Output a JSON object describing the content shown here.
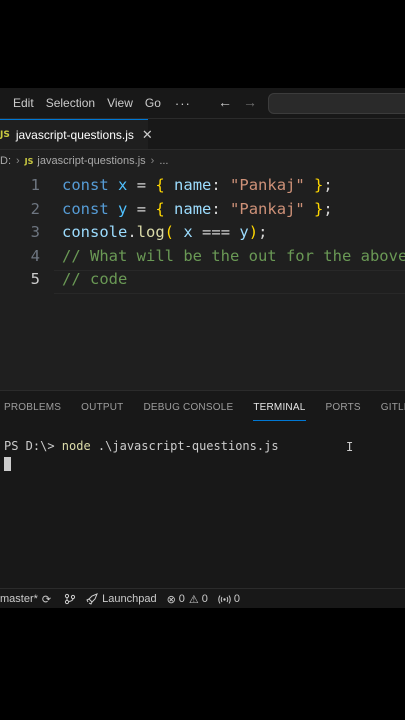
{
  "menubar": {
    "items": [
      "Edit",
      "Selection",
      "View",
      "Go"
    ],
    "more": "···",
    "back_icon": "←",
    "forward_icon": "→"
  },
  "tab": {
    "badge": "JS",
    "filename": "javascript-questions.js",
    "close": "✕"
  },
  "breadcrumb": {
    "drive": "D:",
    "separator": "›",
    "badge": "JS",
    "file": "javascript-questions.js",
    "more": "..."
  },
  "editor": {
    "lines": [
      {
        "no": "1",
        "tokens": [
          [
            "kw",
            "const"
          ],
          [
            "pl",
            " "
          ],
          [
            "var",
            "x"
          ],
          [
            "pl",
            " = "
          ],
          [
            "br",
            "{"
          ],
          [
            "pl",
            " "
          ],
          [
            "prop",
            "name"
          ],
          [
            "pl",
            ": "
          ],
          [
            "str",
            "\"Pankaj\""
          ],
          [
            "pl",
            " "
          ],
          [
            "br",
            "}"
          ],
          [
            "pl",
            ";"
          ]
        ]
      },
      {
        "no": "2",
        "tokens": [
          [
            "kw",
            "const"
          ],
          [
            "pl",
            " "
          ],
          [
            "var",
            "y"
          ],
          [
            "pl",
            " = "
          ],
          [
            "br",
            "{"
          ],
          [
            "pl",
            " "
          ],
          [
            "prop",
            "name"
          ],
          [
            "pl",
            ": "
          ],
          [
            "str",
            "\"Pankaj\""
          ],
          [
            "pl",
            " "
          ],
          [
            "br",
            "}"
          ],
          [
            "pl",
            ";"
          ]
        ]
      },
      {
        "no": "3",
        "tokens": [
          [
            "prop",
            "console"
          ],
          [
            "pl",
            "."
          ],
          [
            "fn",
            "log"
          ],
          [
            "br",
            "("
          ],
          [
            "pl",
            " "
          ],
          [
            "prop",
            "x"
          ],
          [
            "pl",
            " === "
          ],
          [
            "prop",
            "y"
          ],
          [
            "br",
            ")"
          ],
          [
            "pl",
            ";"
          ]
        ]
      },
      {
        "no": "4",
        "tokens": [
          [
            "cm",
            "// What will be the out for the above"
          ]
        ]
      },
      {
        "no": "5",
        "tokens": [
          [
            "cm",
            "// code"
          ]
        ]
      }
    ],
    "active_line": 5
  },
  "panel": {
    "tabs": [
      "PROBLEMS",
      "OUTPUT",
      "DEBUG CONSOLE",
      "TERMINAL",
      "PORTS",
      "GITLENS"
    ],
    "active_tab": "TERMINAL",
    "terminal_prompt": "PS D:\\> ",
    "terminal_command": "node",
    "terminal_args": " .\\javascript-questions.js",
    "ibeam": "I"
  },
  "statusbar": {
    "branch": "master*",
    "sync_icon": "⟳",
    "launchpad_icon": "🚀",
    "launchpad": "Launchpad",
    "errors_icon": "⊗",
    "errors": "0",
    "warnings_icon": "⚠",
    "warnings": "0",
    "ports_icon": "((·))",
    "ports": "0"
  },
  "colors": {
    "accent": "#0078d4",
    "editor_bg": "#1f1f1f",
    "chrome_bg": "#181818",
    "keyword": "#569cd6",
    "string": "#ce9178",
    "comment": "#6a9955"
  }
}
